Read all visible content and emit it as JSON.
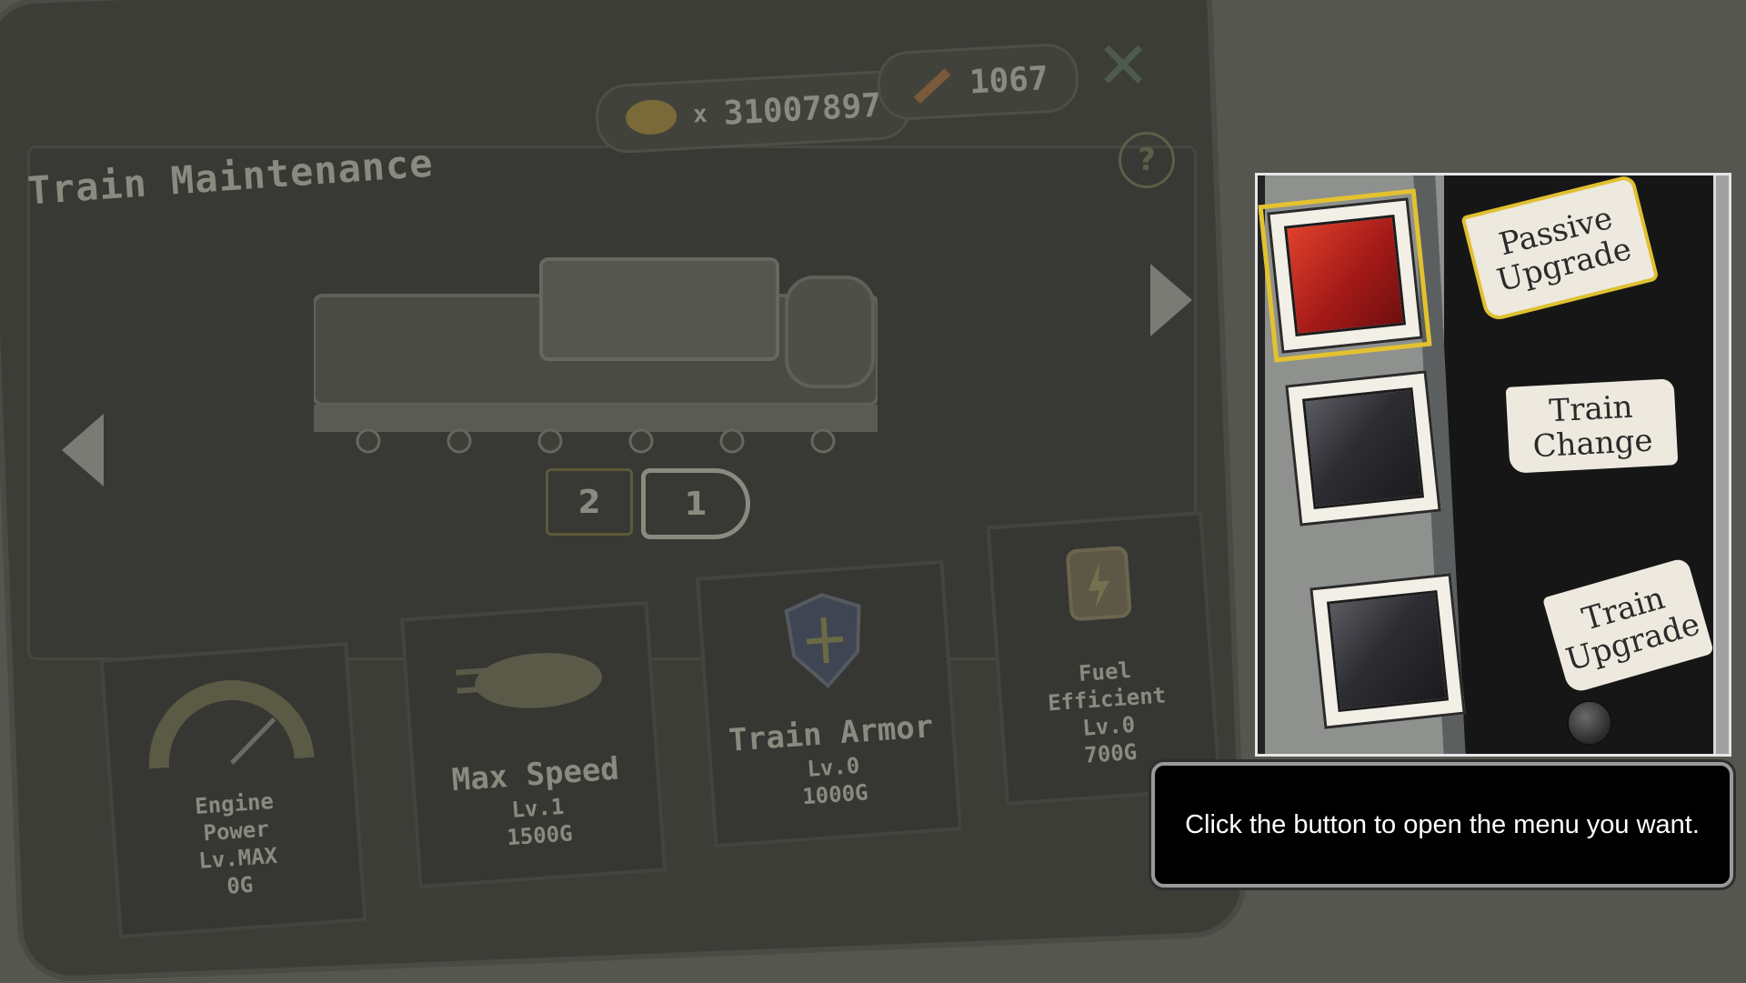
{
  "screen": {
    "title": "Train Maintenance",
    "gold_amount": "31007897",
    "gold_prefix": "x",
    "material_amount": "1067",
    "car_numbers": [
      "2",
      "1"
    ]
  },
  "stats": [
    {
      "name_lines": [
        "Engine",
        "Power"
      ],
      "level": "Lv.MAX",
      "cost": "0G"
    },
    {
      "name_lines": [
        "Max Speed"
      ],
      "level": "Lv.1",
      "cost": "1500G"
    },
    {
      "name_lines": [
        "Train Armor"
      ],
      "level": "Lv.0",
      "cost": "1000G"
    },
    {
      "name_lines": [
        "Fuel",
        "Efficient"
      ],
      "level": "Lv.0",
      "cost": "700G"
    }
  ],
  "menu": {
    "buttons": [
      {
        "label": "Passive Upgrade",
        "color": "red",
        "selected": true
      },
      {
        "label": "Train Change",
        "color": "dark",
        "selected": false
      },
      {
        "label": "Train Upgrade",
        "color": "dark",
        "selected": false
      }
    ],
    "highlight_color": "#e2c230"
  },
  "tooltip": {
    "text": "Click the button to open the menu you want."
  },
  "icons": [
    "coin-icon",
    "arrow-icon",
    "help-icon",
    "close-icon",
    "gauge-icon",
    "speed-icon",
    "shield-icon",
    "fuel-icon"
  ]
}
